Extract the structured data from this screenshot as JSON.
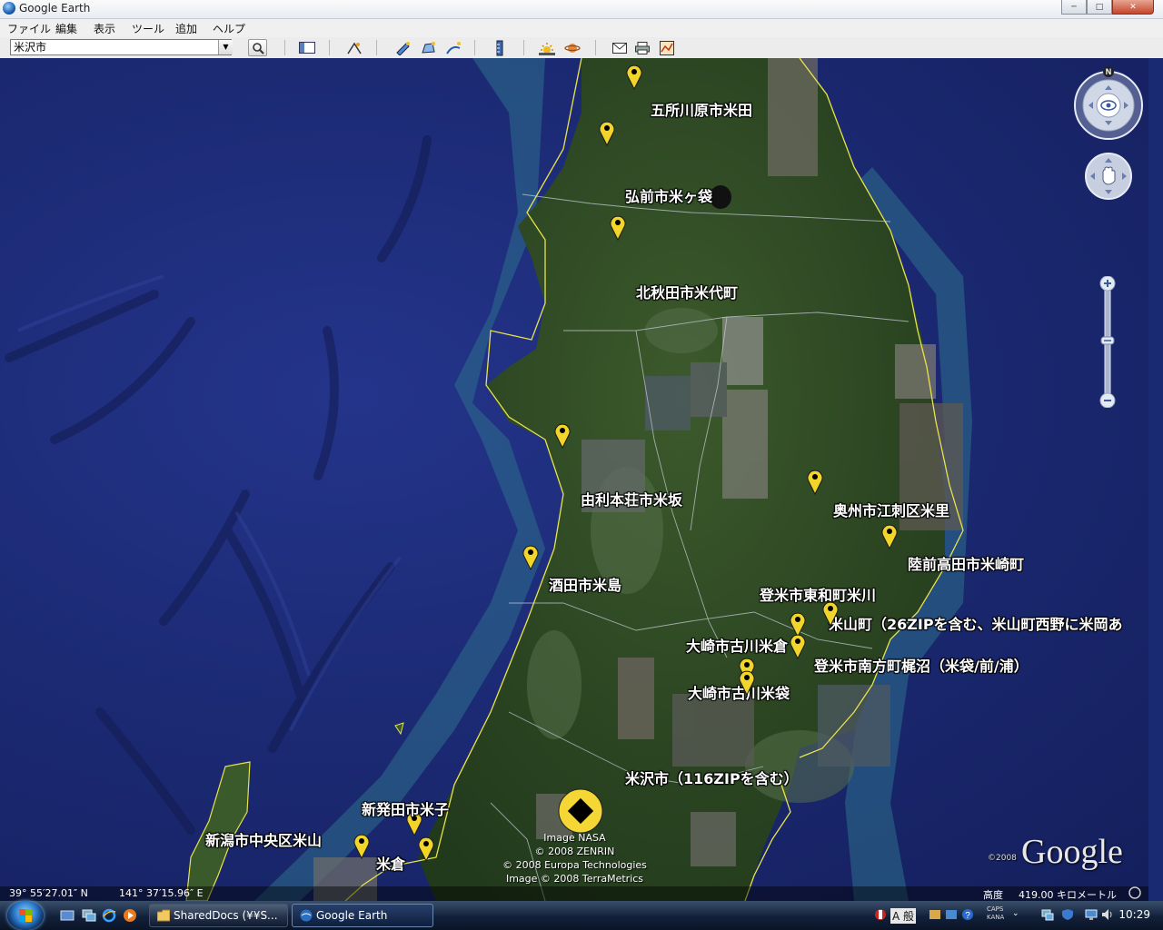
{
  "window": {
    "title": "Google Earth",
    "min_label": "─",
    "max_label": "□",
    "close_label": "✕"
  },
  "menu": [
    "ファイル",
    "編集",
    "表示",
    "ツール",
    "追加",
    "ヘルプ"
  ],
  "search": {
    "value": "米沢市"
  },
  "toolbar_icons": [
    "search-icon",
    "sidebar-icon",
    "tour-icon",
    "placemark-icon",
    "polygon-icon",
    "path-icon",
    "overlay-icon",
    "ruler-icon",
    "sun-icon",
    "planet-icon",
    "email-icon",
    "print-icon",
    "map-view-icon"
  ],
  "placemarks": [
    {
      "label": "五所川原市米田"
    },
    {
      "label": "弘前市米ヶ袋"
    },
    {
      "label": "北秋田市米代町"
    },
    {
      "label": "由利本荘市米坂"
    },
    {
      "label": "奥州市江刺区米里"
    },
    {
      "label": "陸前高田市米崎町"
    },
    {
      "label": "酒田市米島"
    },
    {
      "label": "登米市東和町米川"
    },
    {
      "label": "米山町（26ZIPを含む、米山町西野に米岡あ"
    },
    {
      "label": "大崎市古川米倉"
    },
    {
      "label": "登米市南方町梶沼（米袋/前/浦）"
    },
    {
      "label": "大崎市古川米袋"
    },
    {
      "label": "米沢市（116ZIPを含む）"
    },
    {
      "label": "新発田市米子"
    },
    {
      "label": "新潟市中央区米山"
    },
    {
      "label": "米倉"
    }
  ],
  "attribution": {
    "line1": "Image NASA",
    "line2": "© 2008 ZENRIN",
    "line3": "© 2008 Europa Technologies",
    "line4": "Image © 2008 TerraMetrics"
  },
  "logo": {
    "copyright": "©2008",
    "brand": "Google"
  },
  "compass": {
    "north": "N"
  },
  "status": {
    "lat": "39° 55′27.01″ N",
    "lon": "141° 37′15.96″ E",
    "altitude_label": "高度",
    "altitude_value": "419.00 キロメートル"
  },
  "taskbar": {
    "items": [
      {
        "label": "SharedDocs (¥¥S..."
      },
      {
        "label": "Google Earth"
      }
    ],
    "tray_lang": "A 般",
    "caps": "CAPS",
    "kana": "KANA",
    "clock": "10:29"
  },
  "colors": {
    "placemark": "#f2d52a",
    "border": "#e9e34a",
    "ocean": "#1b2972",
    "land": "#2c4a24"
  }
}
